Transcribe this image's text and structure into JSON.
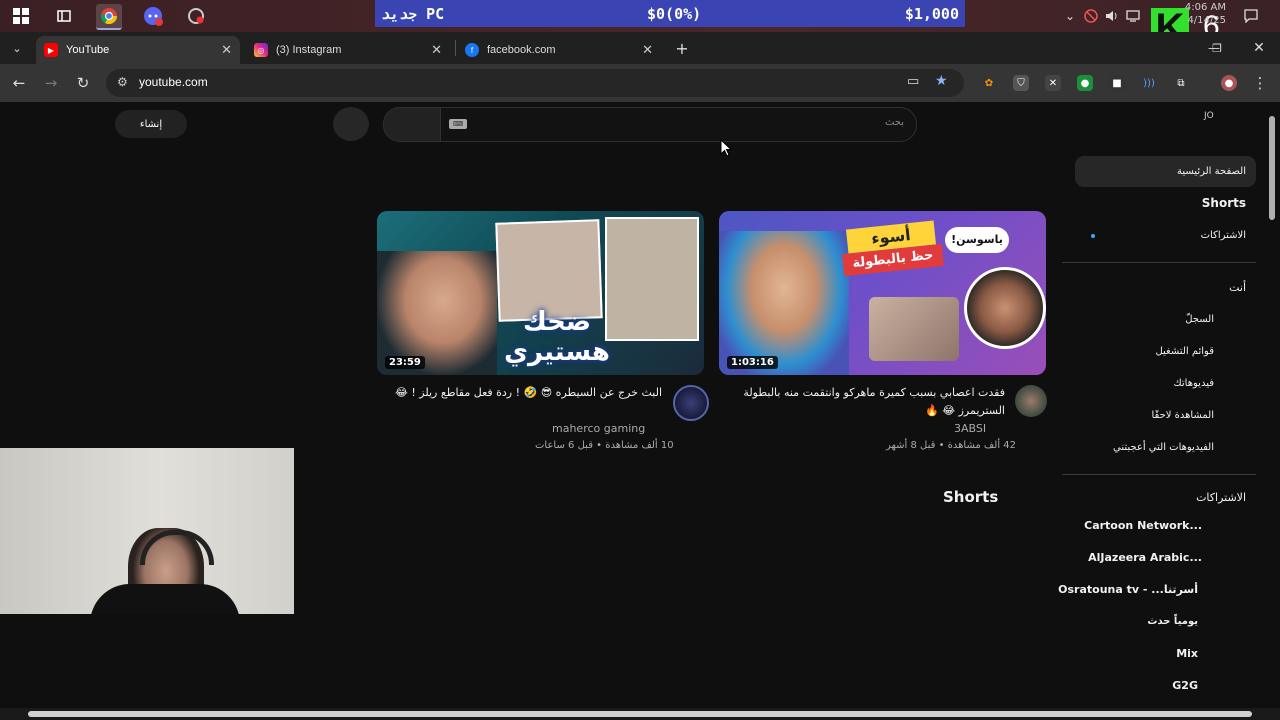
{
  "taskbar": {
    "banner_left": "جديد PC",
    "banner_mid": "$0(0%)",
    "banner_right": "$1,000",
    "clock_time": "4:06 AM",
    "clock_date": "4/14/25",
    "stream_logo": "K",
    "stream_number": "6"
  },
  "tabs": [
    {
      "title": "YouTube",
      "icon": "youtube-icon",
      "color": "#ff0000"
    },
    {
      "title": "(3) Instagram",
      "icon": "instagram-icon",
      "color": "#d6249f"
    },
    {
      "title": "facebook.com",
      "icon": "facebook-icon",
      "color": "#1877f2"
    }
  ],
  "address": {
    "url": "youtube.com"
  },
  "youtube": {
    "create_label": "إنشاء",
    "search_placeholder": "بحث",
    "user_lang": "JO",
    "sidebar": {
      "home": "الصفحة الرئيسية",
      "shorts": "Shorts",
      "subscriptions": "الاشتراكات",
      "you_header": "أنت",
      "history": "السجلّ",
      "playlists": "قوائم التشغيل",
      "your_videos": "فيديوهاتك",
      "watch_later": "المشاهدة لاحقًا",
      "liked_videos": "الفيديوهات التي أعجبتني",
      "subs_header": "الاشتراكات",
      "channels": [
        "Cartoon Network...",
        "AlJazeera Arabic...",
        "Osratouna tv - ...أسرتنا",
        "يومياً حدث",
        "Mix",
        "G2G"
      ]
    },
    "videos": [
      {
        "thumb_text": "ضحك هستيري",
        "duration": "23:59",
        "title": "البث خرج عن السيطره 😎 🤣 ! ردة فعل مقاطع ريلز ! 😂",
        "channel": "maherco gaming",
        "meta": "10 ألف مشاهدة • قبل 6 ساعات"
      },
      {
        "thumb_text_1": "أسوء",
        "thumb_text_2": "حظ بالبطولة",
        "thumb_bubble": "!ياسوسن",
        "duration": "1:03:16",
        "title": "فقدت اعصابي بسبب كميرة ماهركو وانتقمت منه بالبطولة الستريمرز 😂 🔥",
        "channel": "3ABSI",
        "meta": "42 ألف مشاهدة • قبل 8 أشهر"
      }
    ],
    "shorts_heading": "Shorts"
  }
}
